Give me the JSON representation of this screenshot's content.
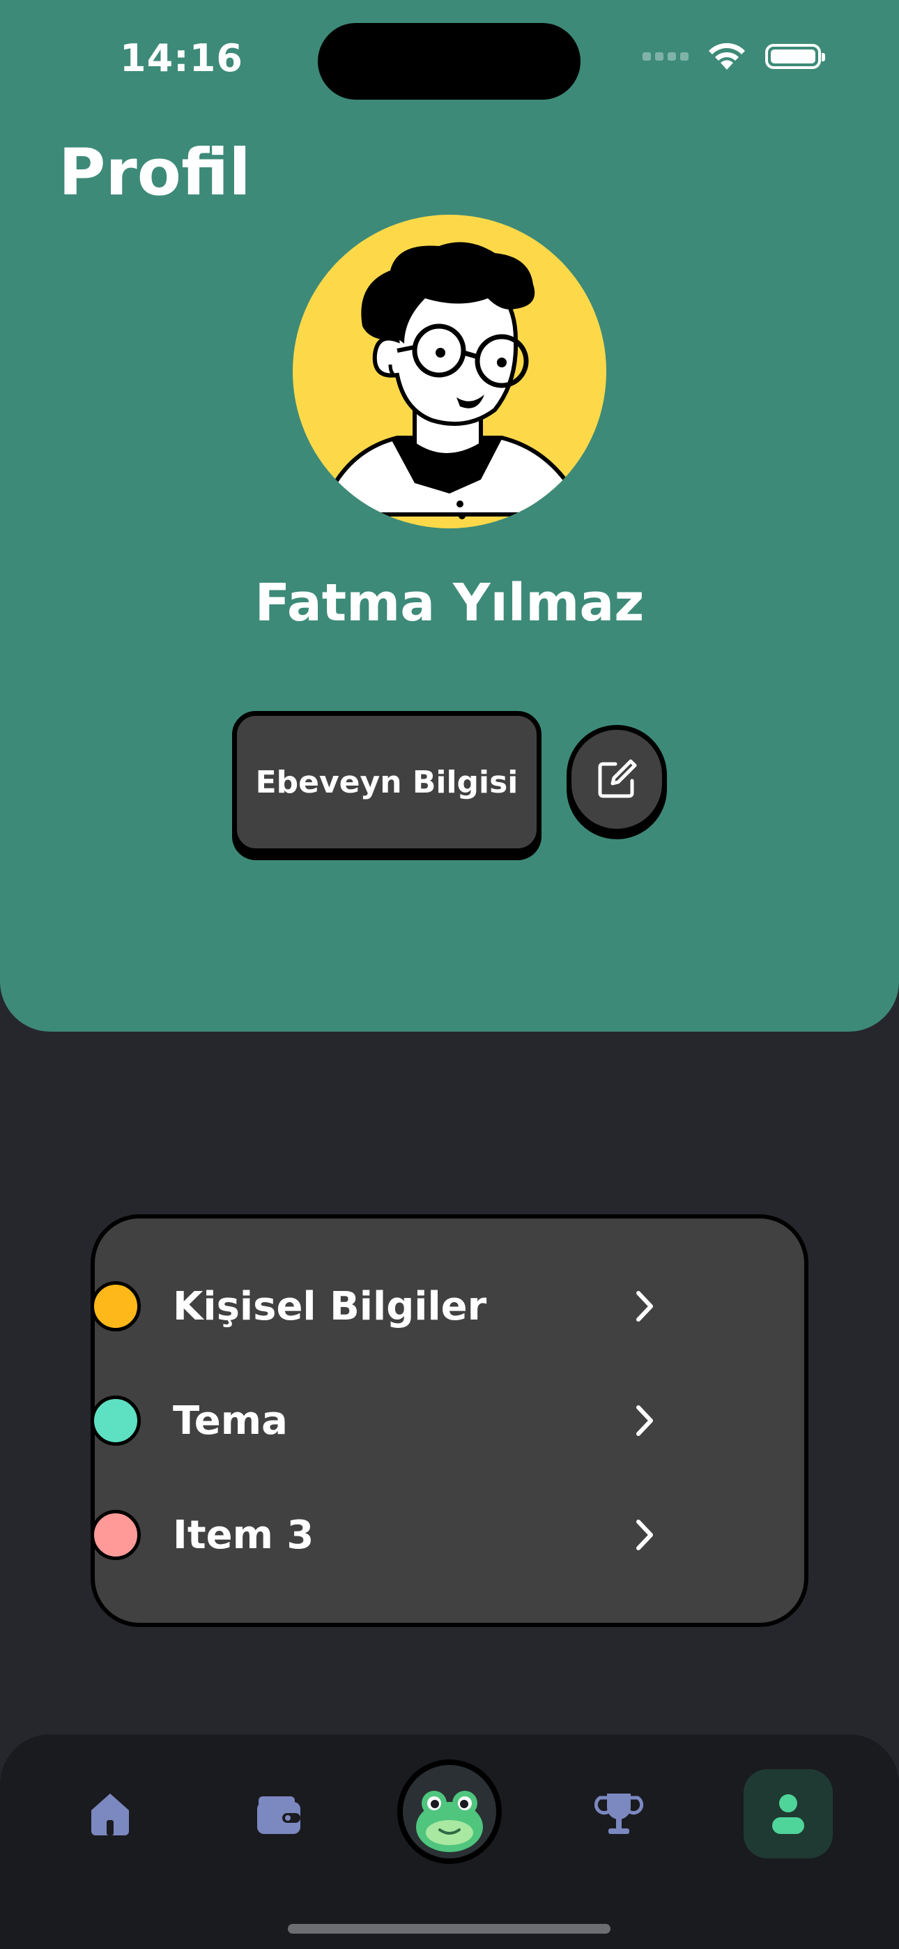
{
  "status_bar": {
    "time": "14:16"
  },
  "header": {
    "title": "Profil"
  },
  "profile": {
    "name": "Fatma Yılmaz",
    "parent_info_label": "Ebeveyn Bilgisi"
  },
  "menu": {
    "items": [
      {
        "label": "Kişisel Bilgiler",
        "color": "#ffb81a"
      },
      {
        "label": "Tema",
        "color": "#5ee0c2"
      },
      {
        "label": "Item 3",
        "color": "#ff9a98"
      }
    ]
  },
  "bottom_nav": {
    "items": [
      {
        "icon": "home-icon"
      },
      {
        "icon": "wallet-icon"
      },
      {
        "icon": "frog-mascot-icon"
      },
      {
        "icon": "trophy-icon"
      },
      {
        "icon": "profile-icon",
        "active": true
      }
    ]
  },
  "colors": {
    "header_green": "#3d8a78",
    "background": "#26272c",
    "card": "#424142",
    "nav_icon": "#7c88c0",
    "active_icon": "#4fd49a"
  }
}
